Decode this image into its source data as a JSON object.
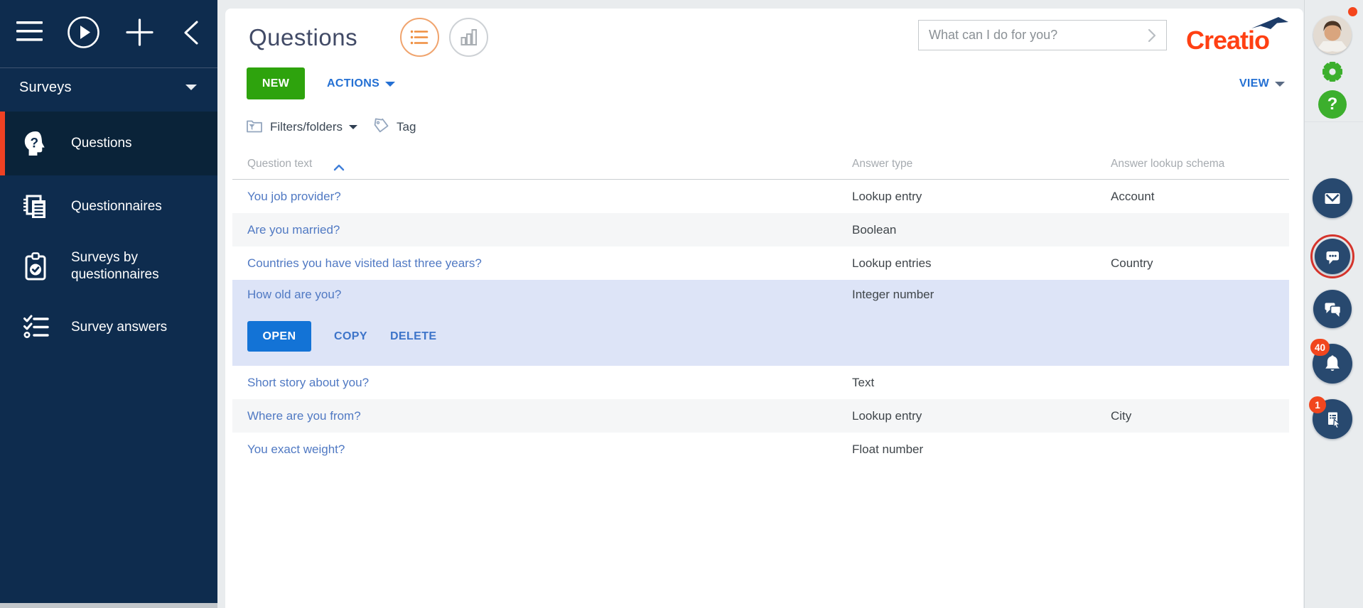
{
  "brand": {
    "logo_text": "Creatio",
    "logo_color": "#FF4013",
    "plane_color": "#1D3C68"
  },
  "sidebar": {
    "workspace_label": "Surveys",
    "items": [
      {
        "label": "Questions",
        "icon": "question-head-icon",
        "active": true
      },
      {
        "label": "Questionnaires",
        "icon": "documents-icon",
        "active": false
      },
      {
        "label": "Surveys by questionnaires",
        "icon": "clipboard-check-icon",
        "active": false
      },
      {
        "label": "Survey answers",
        "icon": "checklist-icon",
        "active": false
      }
    ]
  },
  "header": {
    "title": "Questions",
    "search_placeholder": "What can I do for you?",
    "view_label": "VIEW"
  },
  "toolbar": {
    "new_label": "NEW",
    "actions_label": "ACTIONS",
    "filters_label": "Filters/folders",
    "tag_label": "Tag"
  },
  "table": {
    "columns": [
      "Question text",
      "Answer type",
      "Answer lookup schema"
    ],
    "sorted_by": "Question text",
    "sort_direction": "ascending",
    "rows": [
      {
        "question": "You job provider?",
        "answer_type": "Lookup entry",
        "lookup_schema": "Account",
        "selected": false
      },
      {
        "question": "Are you married?",
        "answer_type": "Boolean",
        "lookup_schema": "",
        "selected": false
      },
      {
        "question": "Countries you have visited last three years?",
        "answer_type": "Lookup entries",
        "lookup_schema": "Country",
        "selected": false
      },
      {
        "question": "How old are you?",
        "answer_type": "Integer number",
        "lookup_schema": "",
        "selected": true
      },
      {
        "question": "Short story about you?",
        "answer_type": "Text",
        "lookup_schema": "",
        "selected": false
      },
      {
        "question": "Where are you from?",
        "answer_type": "Lookup entry",
        "lookup_schema": "City",
        "selected": false
      },
      {
        "question": "You exact weight?",
        "answer_type": "Float number",
        "lookup_schema": "",
        "selected": false
      }
    ],
    "row_actions": {
      "open": "OPEN",
      "copy": "COPY",
      "delete": "DELETE"
    }
  },
  "right_panel": {
    "notifications_badge": "40",
    "process_tasks_badge": "1"
  },
  "colors": {
    "sidebar_bg": "#0E2C4E",
    "sidebar_active_bg": "#0A2339",
    "accent_orange": "#EF4123",
    "new_button_green": "#2EA30D",
    "primary_blue": "#1373D6",
    "link_blue": "#5079C3",
    "selected_row_bg": "#DDE4F7",
    "comm_icon_navy": "#28496F",
    "badge_red": "#F1461E"
  }
}
